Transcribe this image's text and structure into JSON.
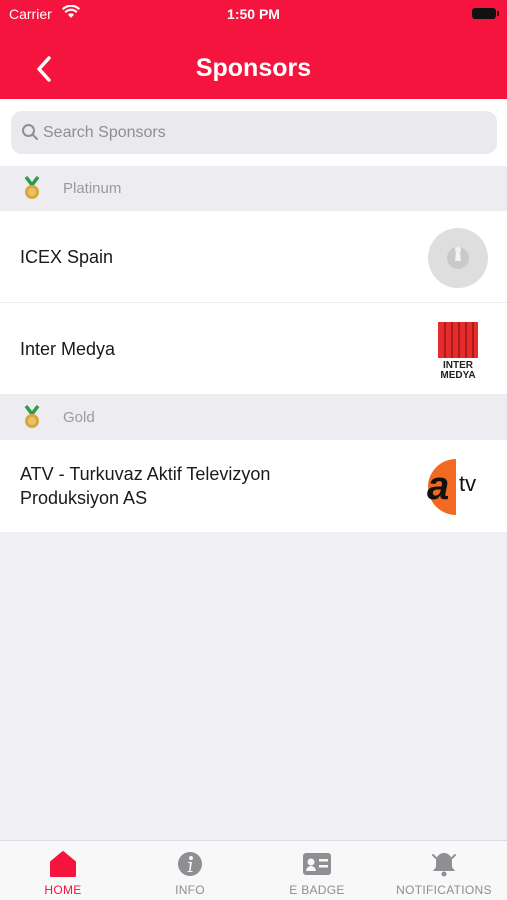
{
  "status_bar": {
    "carrier": "Carrier",
    "time": "1:50 PM"
  },
  "nav": {
    "title": "Sponsors",
    "back_icon": "chevron-left-icon"
  },
  "search": {
    "placeholder": "Search Sponsors",
    "value": ""
  },
  "sections": [
    {
      "label": "Platinum",
      "icon": "medal-icon",
      "sponsors": [
        {
          "name": "ICEX Spain",
          "logo": "placeholder-logo"
        },
        {
          "name": "Inter Medya",
          "logo": "inter-medya-logo",
          "logo_text": [
            "INTER",
            "MEDYA"
          ]
        }
      ]
    },
    {
      "label": "Gold",
      "icon": "medal-icon",
      "sponsors": [
        {
          "name_lines": [
            "ATV - Turkuvaz Aktif Televizyon",
            "Produksiyon AS"
          ],
          "logo": "atv-logo",
          "logo_text": [
            "a",
            "tv"
          ]
        }
      ]
    }
  ],
  "tabs": [
    {
      "label": "HOME",
      "icon": "home-icon",
      "active": true
    },
    {
      "label": "INFO",
      "icon": "info-icon",
      "active": false
    },
    {
      "label": "E BADGE",
      "icon": "badge-icon",
      "active": false
    },
    {
      "label": "NOTIFICATIONS",
      "icon": "bell-icon",
      "active": false
    }
  ],
  "colors": {
    "accent": "#f4143e",
    "background": "#efeff4",
    "section_bg": "#ececf1",
    "tab_inactive": "#8e8e93"
  }
}
